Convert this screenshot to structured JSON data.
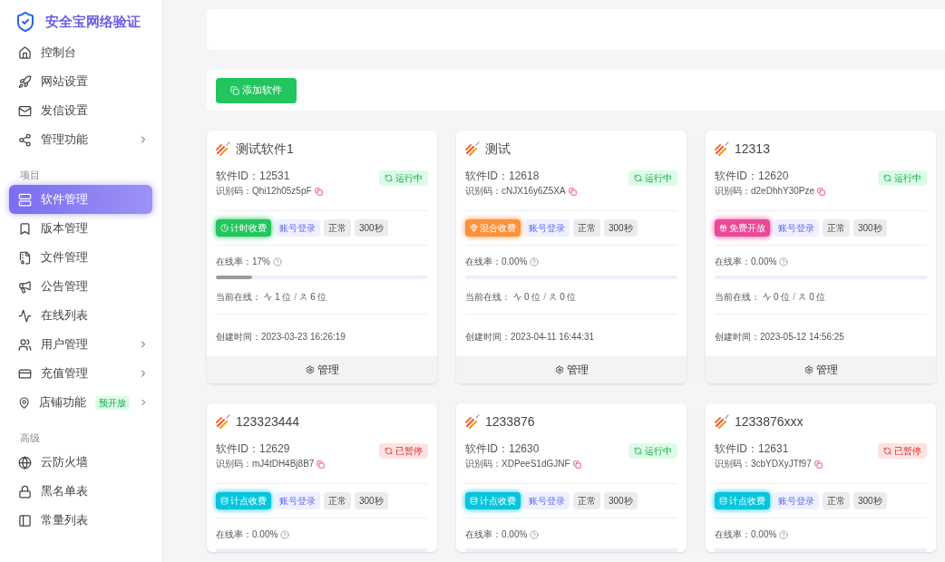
{
  "brand": {
    "title": "安全宝网络验证"
  },
  "sidebar": {
    "groups": [
      {
        "items": [
          {
            "label": "控制台",
            "selected": false,
            "expandable": false
          },
          {
            "label": "网站设置",
            "selected": false,
            "expandable": false
          },
          {
            "label": "发信设置",
            "selected": false,
            "expandable": false
          },
          {
            "label": "管理功能",
            "selected": false,
            "expandable": true
          }
        ]
      },
      {
        "heading": "项目",
        "items": [
          {
            "label": "软件管理",
            "selected": true,
            "expandable": false
          },
          {
            "label": "版本管理",
            "selected": false,
            "expandable": false
          },
          {
            "label": "文件管理",
            "selected": false,
            "expandable": false
          },
          {
            "label": "公告管理",
            "selected": false,
            "expandable": false
          },
          {
            "label": "在线列表",
            "selected": false,
            "expandable": false
          },
          {
            "label": "用户管理",
            "selected": false,
            "expandable": true
          },
          {
            "label": "充值管理",
            "selected": false,
            "expandable": true
          },
          {
            "label": "店铺功能",
            "selected": false,
            "expandable": true,
            "badge": "预开放"
          }
        ]
      },
      {
        "heading": "高级",
        "items": [
          {
            "label": "云防火墙",
            "selected": false,
            "expandable": false
          },
          {
            "label": "黑名单表",
            "selected": false,
            "expandable": false
          },
          {
            "label": "常量列表",
            "selected": false,
            "expandable": false
          }
        ]
      }
    ]
  },
  "toolbar": {
    "add_button": "添加软件"
  },
  "cards": [
    {
      "name": "测试软件1",
      "id_line": "软件ID：12531",
      "code_line": "识别码：Qhi12h05z5pF",
      "status": {
        "label": "运行中",
        "kind": "running"
      },
      "billing": {
        "label": "计时收费",
        "kind": "timed"
      },
      "tags": [
        "账号登录",
        "正常",
        "300秒"
      ],
      "online_rate": "在线率：17%",
      "level": 0.17,
      "current_online": {
        "label": "当前在线：",
        "active": "1 位",
        "separator": "/",
        "total": "6 位"
      },
      "created": "创建时间：2023-03-23 16:26:19",
      "action": "管理"
    },
    {
      "name": "测试",
      "id_line": "软件ID：12618",
      "code_line": "识别码：cNJX16y6Z5XA",
      "status": {
        "label": "运行中",
        "kind": "running"
      },
      "billing": {
        "label": "混合收费",
        "kind": "mixed"
      },
      "tags": [
        "账号登录",
        "正常",
        "300秒"
      ],
      "online_rate": "在线率：0.00%",
      "current_online": {
        "label": "当前在线：",
        "active": "0 位",
        "separator": "/",
        "total": "0 位"
      },
      "created": "创建时间：2023-04-11 16:44:31",
      "action": "管理"
    },
    {
      "name": "12313",
      "id_line": "软件ID：12620",
      "code_line": "识别码：d2eDhhY30Pze",
      "status": {
        "label": "运行中",
        "kind": "running"
      },
      "billing": {
        "label": "免费开放",
        "kind": "free"
      },
      "tags": [
        "账号登录",
        "正常",
        "300秒"
      ],
      "online_rate": "在线率：0.00%",
      "current_online": {
        "label": "当前在线：",
        "active": "0 位",
        "separator": "/",
        "total": "0 位"
      },
      "created": "创建时间：2023-05-12 14:56:25",
      "action": "管理"
    },
    {
      "name": "123323444",
      "id_line": "软件ID：12629",
      "code_line": "识别码：mJ4tDH4Bj8B7",
      "status": {
        "label": "已暂停",
        "kind": "paused"
      },
      "billing": {
        "label": "计点收费",
        "kind": "points"
      },
      "tags": [
        "账号登录",
        "正常",
        "300秒"
      ],
      "online_rate": "在线率：0.00%"
    },
    {
      "name": "1233876",
      "id_line": "软件ID：12630",
      "code_line": "识别码：XDPeeS1dGJNF",
      "status": {
        "label": "运行中",
        "kind": "running"
      },
      "billing": {
        "label": "计点收费",
        "kind": "points"
      },
      "tags": [
        "账号登录",
        "正常",
        "300秒"
      ],
      "online_rate": "在线率：0.00%"
    },
    {
      "name": "1233876xxx",
      "id_line": "软件ID：12631",
      "code_line": "识别码：3cbYDXyJTf97",
      "status": {
        "label": "已暂停",
        "kind": "paused"
      },
      "billing": {
        "label": "计点收费",
        "kind": "points"
      },
      "tags": [
        "账号登录",
        "正常",
        "300秒"
      ],
      "online_rate": "在线率：0.00%"
    }
  ]
}
